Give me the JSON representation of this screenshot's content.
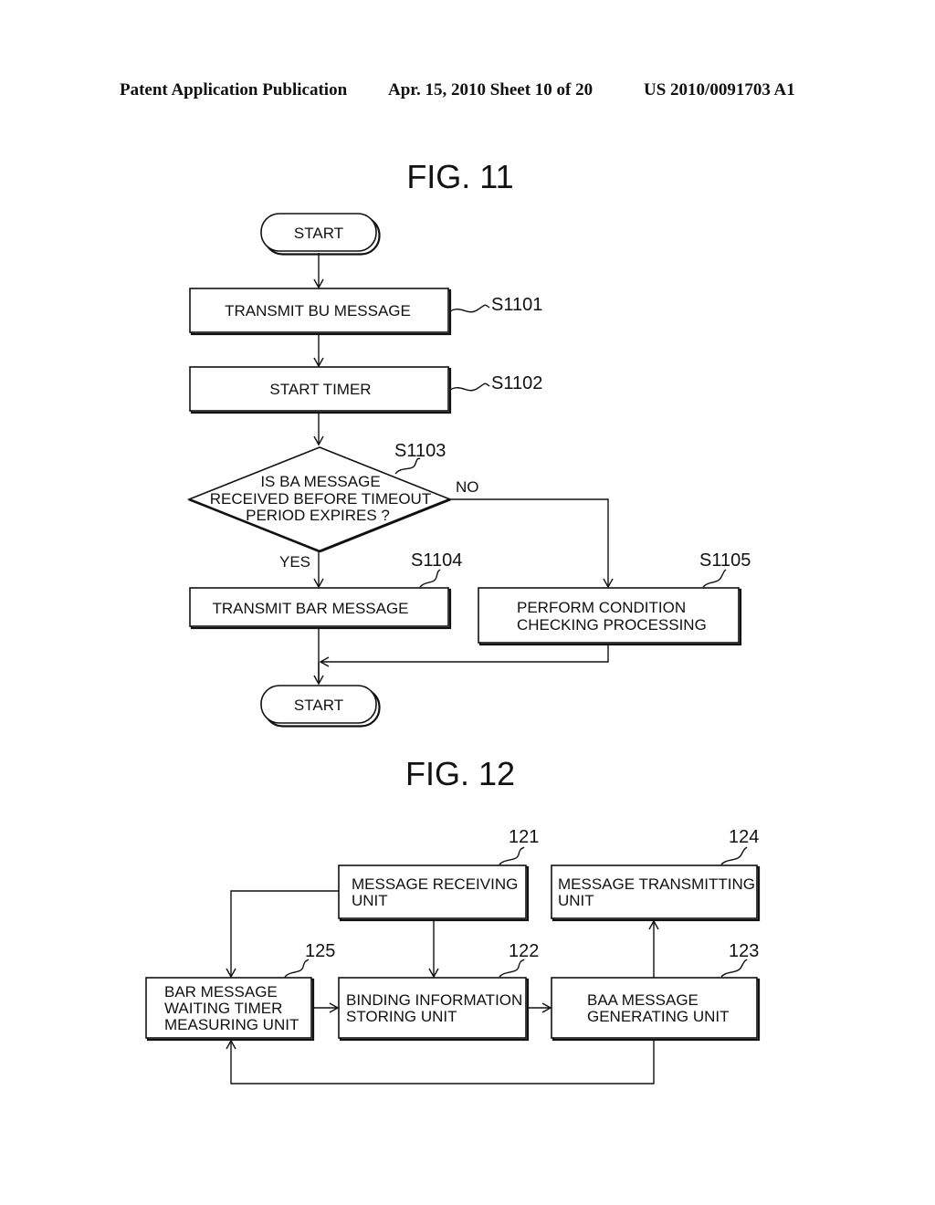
{
  "header": {
    "publication": "Patent Application Publication",
    "date_sheet": "Apr. 15, 2010  Sheet 10 of 20",
    "number": "US 2010/0091703 A1"
  },
  "fig11": {
    "title": "FIG. 11",
    "start": "START",
    "s1101": {
      "label": "TRANSMIT BU MESSAGE",
      "ref": "S1101"
    },
    "s1102": {
      "label": "START TIMER",
      "ref": "S1102"
    },
    "s1103": {
      "lines": [
        "IS BA MESSAGE",
        "RECEIVED BEFORE TIMEOUT",
        "PERIOD EXPIRES ?"
      ],
      "ref": "S1103",
      "yes": "YES",
      "no": "NO"
    },
    "s1104": {
      "label": "TRANSMIT BAR MESSAGE",
      "ref": "S1104"
    },
    "s1105": {
      "lines": [
        "PERFORM CONDITION",
        "CHECKING PROCESSING"
      ],
      "ref": "S1105"
    },
    "end": "START"
  },
  "fig12": {
    "title": "FIG. 12",
    "u121": {
      "lines": [
        "MESSAGE RECEIVING",
        "UNIT"
      ],
      "ref": "121"
    },
    "u124": {
      "lines": [
        "MESSAGE TRANSMITTING",
        "UNIT"
      ],
      "ref": "124"
    },
    "u125": {
      "lines": [
        "BAR MESSAGE",
        "WAITING TIMER",
        "MEASURING UNIT"
      ],
      "ref": "125"
    },
    "u122": {
      "lines": [
        "BINDING INFORMATION",
        "STORING UNIT"
      ],
      "ref": "122"
    },
    "u123": {
      "lines": [
        "BAA MESSAGE",
        "GENERATING UNIT"
      ],
      "ref": "123"
    }
  }
}
